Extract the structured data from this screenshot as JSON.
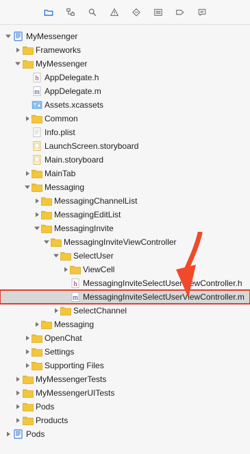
{
  "toolbar": {
    "items": [
      {
        "name": "folder-tab-icon",
        "active": true
      },
      {
        "name": "hierarchy-tab-icon"
      },
      {
        "name": "search-tab-icon"
      },
      {
        "name": "warning-tab-icon"
      },
      {
        "name": "diamond-tab-icon"
      },
      {
        "name": "list-tab-icon"
      },
      {
        "name": "tag-tab-icon"
      },
      {
        "name": "comment-tab-icon"
      }
    ]
  },
  "tree": {
    "items": [
      {
        "label": "MyMessenger"
      },
      {
        "label": "Frameworks"
      },
      {
        "label": "MyMessenger"
      },
      {
        "label": "AppDelegate.h"
      },
      {
        "label": "AppDelegate.m"
      },
      {
        "label": "Assets.xcassets"
      },
      {
        "label": "Common"
      },
      {
        "label": "Info.plist"
      },
      {
        "label": "LaunchScreen.storyboard"
      },
      {
        "label": "Main.storyboard"
      },
      {
        "label": "MainTab"
      },
      {
        "label": "Messaging"
      },
      {
        "label": "MessagingChannelList"
      },
      {
        "label": "MessagingEditList"
      },
      {
        "label": "MessagingInvite"
      },
      {
        "label": "MessagingInviteViewController"
      },
      {
        "label": "SelectUser"
      },
      {
        "label": "ViewCell"
      },
      {
        "label": "MessagingInviteSelectUserViewController.h"
      },
      {
        "label": "MessagingInviteSelectUserViewController.m"
      },
      {
        "label": "SelectChannel"
      },
      {
        "label": "Messaging"
      },
      {
        "label": "OpenChat"
      },
      {
        "label": "Settings"
      },
      {
        "label": "Supporting Files"
      },
      {
        "label": "MyMessengerTests"
      },
      {
        "label": "MyMessengerUITests"
      },
      {
        "label": "Pods"
      },
      {
        "label": "Products"
      },
      {
        "label": "Pods"
      }
    ]
  },
  "colors": {
    "folder": "#f3c63b",
    "folderDark": "#d9a927",
    "selection": "#d8d8d8",
    "highlight": "#e53d2d",
    "hfile": "#8b1f3a",
    "mfile": "#274b8f",
    "project": "#2f73d8"
  }
}
